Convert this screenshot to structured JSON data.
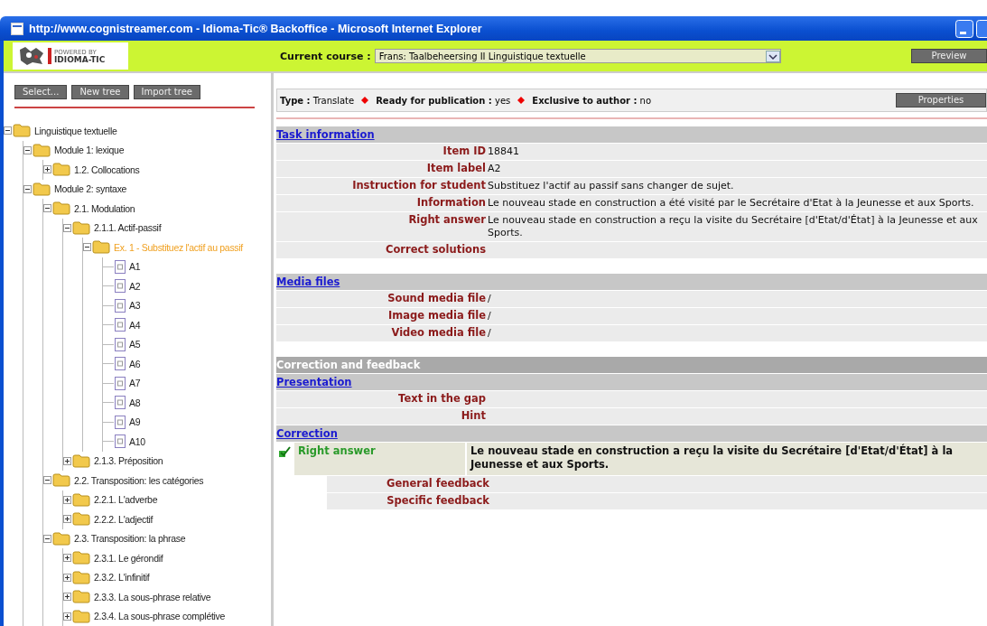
{
  "window": {
    "title": "http://www.cognistreamer.com - Idioma-Tic® Backoffice - Microsoft Internet Explorer"
  },
  "header": {
    "logo_small": "POWERED BY",
    "logo_text": "IDIOMA-TIC",
    "course_label": "Current course :",
    "course_value": "Frans: Taalbeheersing II Linguistique textuelle",
    "preview_button": "Preview"
  },
  "sidebar": {
    "buttons": [
      "Select...",
      "New tree",
      "Import tree"
    ],
    "tree": [
      {
        "label": "Linguistique textuelle",
        "kind": "folder",
        "expanded": true,
        "selected": false,
        "children": [
          {
            "label": "Module 1: lexique",
            "kind": "folder",
            "expanded": true,
            "selected": false,
            "children": [
              {
                "label": "1.2. Collocations",
                "kind": "folder",
                "expanded": false,
                "selected": false
              }
            ]
          },
          {
            "label": "Module 2: syntaxe",
            "kind": "folder",
            "expanded": true,
            "selected": false,
            "children": [
              {
                "label": "2.1. Modulation",
                "kind": "folder",
                "expanded": true,
                "selected": false,
                "children": [
                  {
                    "label": "2.1.1. Actif-passif",
                    "kind": "folder",
                    "expanded": true,
                    "selected": false,
                    "children": [
                      {
                        "label": "Ex. 1 - Substituez l'actif au passif",
                        "kind": "folder",
                        "expanded": true,
                        "selected": true,
                        "children": [
                          {
                            "label": "A1",
                            "kind": "item",
                            "selected": false
                          },
                          {
                            "label": "A2",
                            "kind": "item",
                            "selected": false
                          },
                          {
                            "label": "A3",
                            "kind": "item",
                            "selected": false
                          },
                          {
                            "label": "A4",
                            "kind": "item",
                            "selected": false
                          },
                          {
                            "label": "A5",
                            "kind": "item",
                            "selected": false
                          },
                          {
                            "label": "A6",
                            "kind": "item",
                            "selected": false
                          },
                          {
                            "label": "A7",
                            "kind": "item",
                            "selected": false
                          },
                          {
                            "label": "A8",
                            "kind": "item",
                            "selected": false
                          },
                          {
                            "label": "A9",
                            "kind": "item",
                            "selected": false
                          },
                          {
                            "label": "A10",
                            "kind": "item",
                            "selected": false
                          }
                        ]
                      }
                    ]
                  },
                  {
                    "label": "2.1.3. Préposition",
                    "kind": "folder",
                    "expanded": false,
                    "selected": false
                  }
                ]
              },
              {
                "label": "2.2. Transposition: les catégories",
                "kind": "folder",
                "expanded": true,
                "selected": false,
                "children": [
                  {
                    "label": "2.2.1. L'adverbe",
                    "kind": "folder",
                    "expanded": false,
                    "selected": false
                  },
                  {
                    "label": "2.2.2. L'adjectif",
                    "kind": "folder",
                    "expanded": false,
                    "selected": false
                  }
                ]
              },
              {
                "label": "2.3. Transposition: la phrase",
                "kind": "folder",
                "expanded": true,
                "selected": false,
                "children": [
                  {
                    "label": "2.3.1. Le gérondif",
                    "kind": "folder",
                    "expanded": false,
                    "selected": false
                  },
                  {
                    "label": "2.3.2. L'infinitif",
                    "kind": "folder",
                    "expanded": false,
                    "selected": false
                  },
                  {
                    "label": "2.3.3. La sous-phrase relative",
                    "kind": "folder",
                    "expanded": false,
                    "selected": false
                  },
                  {
                    "label": "2.3.4. La sous-phrase complétive",
                    "kind": "folder",
                    "expanded": false,
                    "selected": false
                  }
                ]
              }
            ]
          }
        ]
      }
    ]
  },
  "info_bar": {
    "fields": [
      {
        "label": "Type :",
        "value": "Translate"
      },
      {
        "label": "Ready for publication :",
        "value": "yes"
      },
      {
        "label": "Exclusive to author :",
        "value": "no"
      }
    ],
    "properties_button": "Properties"
  },
  "blocks": [
    {
      "kind": "section",
      "title": "Task information"
    },
    {
      "kind": "field",
      "label": "Item ID",
      "value": "18841"
    },
    {
      "kind": "field",
      "label": "Item label",
      "value": "A2"
    },
    {
      "kind": "field",
      "label": "Instruction for student",
      "value": "Substituez l'actif au passif sans changer de sujet."
    },
    {
      "kind": "field",
      "label": "Information",
      "value": "Le nouveau stade en construction a été visité par le Secrétaire d'Etat à la Jeunesse et aux Sports."
    },
    {
      "kind": "field",
      "label": "Right answer",
      "value": "Le nouveau stade en construction a reçu la visite du Secrétaire [d'Etat/d'État] à la Jeunesse et aux Sports."
    },
    {
      "kind": "field",
      "label": "Correct solutions"
    },
    {
      "kind": "gap"
    },
    {
      "kind": "section",
      "title": "Media files"
    },
    {
      "kind": "field",
      "label": "Sound media file",
      "value": "/"
    },
    {
      "kind": "field",
      "label": "Image media file",
      "value": "/"
    },
    {
      "kind": "field",
      "label": "Video media file",
      "value": "/"
    },
    {
      "kind": "gap"
    },
    {
      "kind": "group",
      "title": "Correction and feedback"
    },
    {
      "kind": "section",
      "title": "Presentation"
    },
    {
      "kind": "field",
      "label": "Text in the gap"
    },
    {
      "kind": "field",
      "label": "Hint"
    },
    {
      "kind": "section",
      "title": "Correction"
    },
    {
      "kind": "answer",
      "label": "Right answer",
      "value": "Le nouveau stade en construction a reçu la visite du Secrétaire [d'Etat/d'État] à la Jeunesse et aux Sports."
    },
    {
      "kind": "subfield",
      "label": "General feedback"
    },
    {
      "kind": "subfield",
      "label": "Specific feedback"
    }
  ]
}
